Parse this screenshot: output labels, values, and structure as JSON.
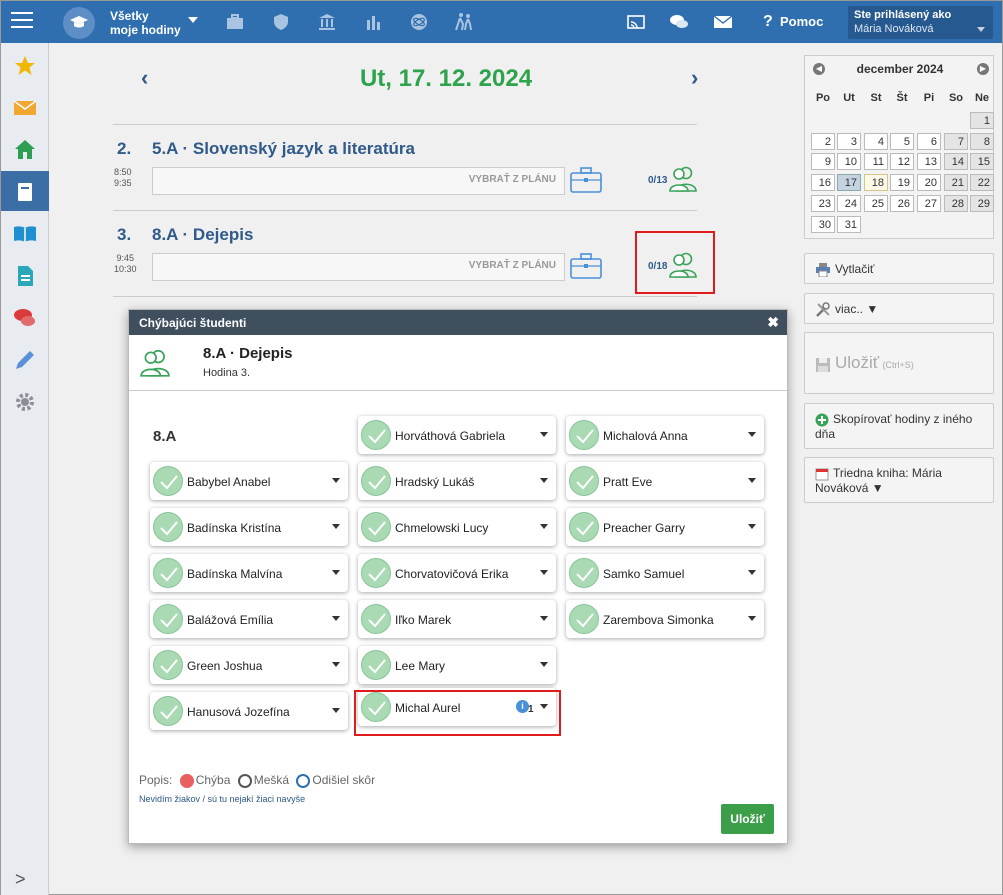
{
  "topbar": {
    "hours_line1": "Všetky",
    "hours_line2": "moje hodiny",
    "help_label": "Pomoc",
    "user_label": "Ste prihlásený ako",
    "user_name": "Mária Nováková"
  },
  "header": {
    "date": "Ut, 17. 12. 2024"
  },
  "lessons": [
    {
      "num": "2.",
      "title": "5.A · Slovenský jazyk a literatúra",
      "time_start": "8:50",
      "time_end": "9:35",
      "plan_label": "VYBRAŤ Z PLÁNU",
      "count": "0/13"
    },
    {
      "num": "3.",
      "title": "8.A · Dejepis",
      "time_start": "9:45",
      "time_end": "10:30",
      "plan_label": "VYBRAŤ Z PLÁNU",
      "count": "0/18"
    }
  ],
  "calendar": {
    "month": "december 2024",
    "dow": [
      "Po",
      "Ut",
      "St",
      "Št",
      "Pi",
      "So",
      "Ne"
    ]
  },
  "right": {
    "print": "Vytlačiť",
    "more": "viac.. ▼",
    "save": "Uložiť",
    "save_hint": "(Ctrl+S)",
    "copy": "Skopírovať hodiny z iného dňa",
    "classbook": "Triedna kniha: Mária Nováková ▼"
  },
  "modal": {
    "title": "Chýbajúci študenti",
    "lesson": "8.A · Dejepis",
    "hour": "Hodina 3.",
    "class": "8.A",
    "students": [
      "Babybel Anabel",
      "Badínska Kristína",
      "Badínska Malvína",
      "Balážová Emília",
      "Green Joshua",
      "Hanusová Jozefína",
      "Horváthová Gabriela",
      "Hradský Lukáš",
      "Chmelowski Lucy",
      "Chorvatovičová Erika",
      "Iľko Marek",
      "Lee Mary",
      "Michal Aurel",
      "Michalová Anna",
      "Pratt Eve",
      "Preacher Garry",
      "Samko Samuel",
      "Zarembova Simonka"
    ],
    "info_count": "1",
    "legend_prefix": "Popis:",
    "legend_absent": "Chýba",
    "legend_late": "Mešká",
    "legend_left": "Odišiel skôr",
    "missing_link": "Nevidím žiakov / sú tu nejakí žiaci navyše",
    "save": "Uložiť"
  }
}
